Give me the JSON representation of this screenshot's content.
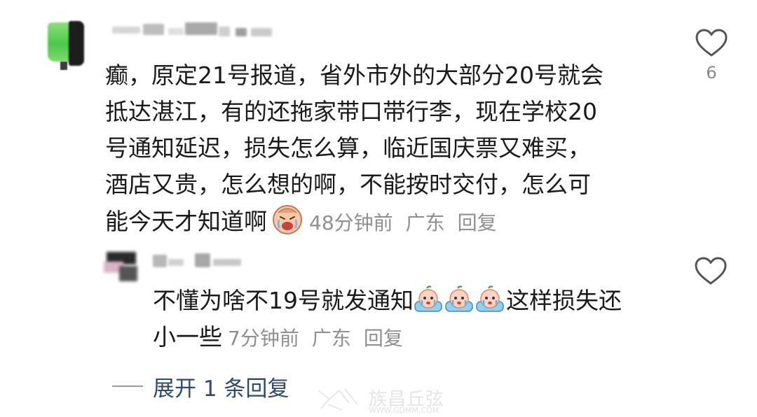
{
  "comment": {
    "lines": [
      "癫，原定21号报道，省外市外的大部分20号就会",
      "抵达湛江，有的还拖家带口带行李，现在学校20",
      "号通知延迟，损失怎么算，临近国庆票又难买，",
      "酒店又贵，怎么想的啊，不能按时交付，怎么可"
    ],
    "last_line": "能今天才知道啊",
    "emoji": "crying-face-sticker",
    "time": "48分钟前",
    "location": "广东",
    "reply_label": "回复",
    "like_count": "6"
  },
  "reply": {
    "line1_before": "不懂为啥不19号就发通知",
    "line1_after": "这样损失还",
    "line2": "小一些",
    "emoji": "peach-crying-sticker",
    "time": "7分钟前",
    "location": "广东",
    "reply_label": "回复"
  },
  "expand": {
    "label": "展开 1 条回复"
  },
  "watermark": {
    "text": "族昌丘弦",
    "url": "WWW.GDMM.COM"
  },
  "colors": {
    "text": "#1a1a1a",
    "meta": "#8f8f8f",
    "link": "#2f4a72"
  }
}
